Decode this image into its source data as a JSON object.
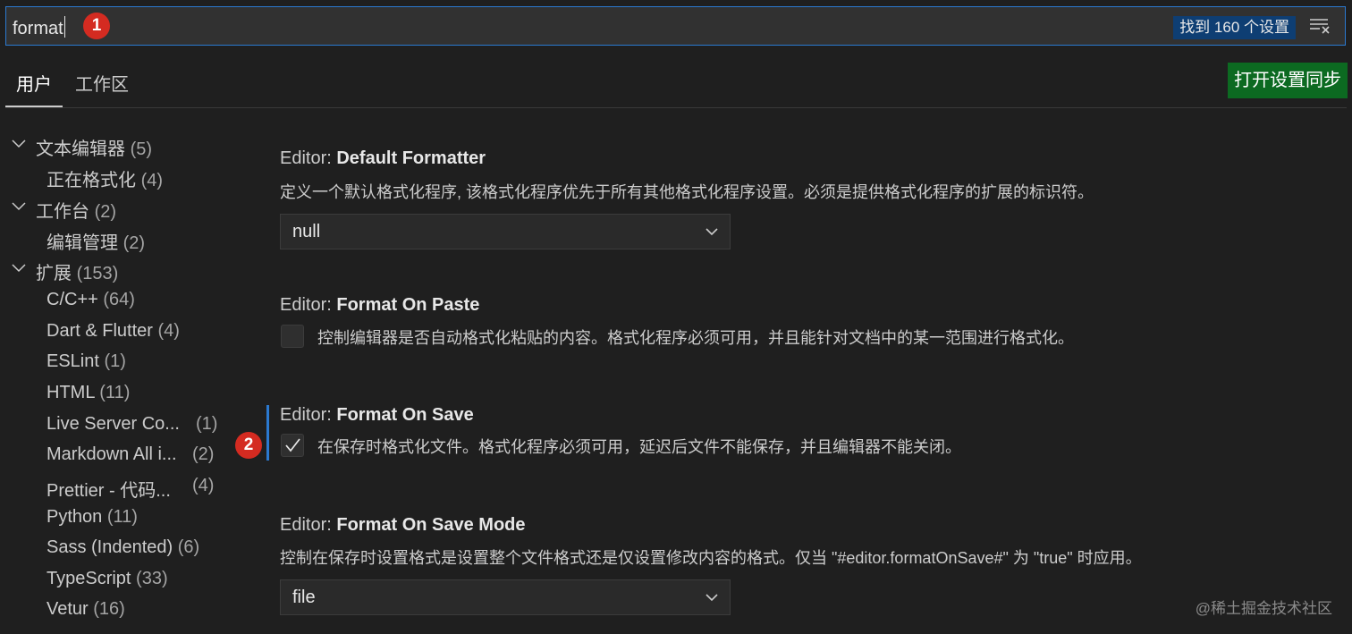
{
  "search": {
    "value": "format",
    "result_count": "找到 160 个设置"
  },
  "markers": [
    "1",
    "2"
  ],
  "tabs": [
    "用户",
    "工作区"
  ],
  "sync_button": "打开设置同步",
  "tree": [
    {
      "label": "文本编辑器",
      "count": "(5)"
    },
    {
      "label": "正在格式化",
      "count": "(4)"
    },
    {
      "label": "工作台",
      "count": "(2)"
    },
    {
      "label": "编辑管理",
      "count": "(2)"
    },
    {
      "label": "扩展",
      "count": "(153)"
    },
    {
      "label": "C/C++",
      "count": "(64)"
    },
    {
      "label": "Dart & Flutter",
      "count": "(4)"
    },
    {
      "label": "ESLint",
      "count": "(1)"
    },
    {
      "label": "HTML",
      "count": "(11)"
    },
    {
      "label": "Live Server Co...",
      "count": "(1)"
    },
    {
      "label": "Markdown All i...",
      "count": "(2)"
    },
    {
      "label": "Prettier - 代码...",
      "count": "(4)"
    },
    {
      "label": "Python",
      "count": "(11)"
    },
    {
      "label": "Sass (Indented)",
      "count": "(6)"
    },
    {
      "label": "TypeScript",
      "count": "(33)"
    },
    {
      "label": "Vetur",
      "count": "(16)"
    }
  ],
  "settings": [
    {
      "prefix": "Editor: ",
      "name": "Default Formatter",
      "desc": "定义一个默认格式化程序, 该格式化程序优先于所有其他格式化程序设置。必须是提供格式化程序的扩展的标识符。",
      "value": "null"
    },
    {
      "prefix": "Editor: ",
      "name": "Format On Paste",
      "desc": "控制编辑器是否自动格式化粘贴的内容。格式化程序必须可用，并且能针对文档中的某一范围进行格式化。",
      "checked": false
    },
    {
      "prefix": "Editor: ",
      "name": "Format On Save",
      "desc": "在保存时格式化文件。格式化程序必须可用，延迟后文件不能保存，并且编辑器不能关闭。",
      "checked": true
    },
    {
      "prefix": "Editor: ",
      "name": "Format On Save Mode",
      "desc": "控制在保存时设置格式是设置整个文件格式还是仅设置修改内容的格式。仅当 \"#editor.formatOnSave#\" 为 \"true\" 时应用。",
      "value": "file"
    }
  ],
  "watermark": "@稀土掘金技术社区",
  "colors": {
    "accent": "#2b79d0",
    "marker": "#d42b21",
    "sync": "#0c6a21",
    "badge": "#0e3e73"
  }
}
